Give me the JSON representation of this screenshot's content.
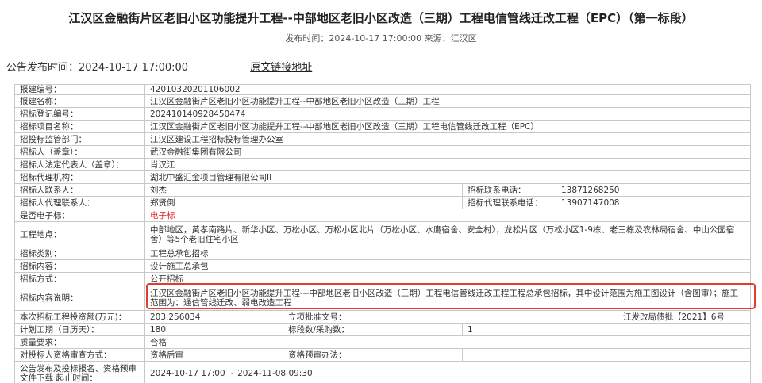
{
  "header": {
    "title": "江汉区金融街片区老旧小区功能提升工程--中部地区老旧小区改造（三期）工程电信管线迁改工程（EPC）（第一标段）",
    "meta": "发布时间：2024-10-17 17:00:00 来源：江汉区"
  },
  "publish": {
    "text": "公告发布时间：2024-10-17 17:00:00",
    "link_label": "原文链接地址"
  },
  "fields": {
    "report_no": {
      "label": "报建编号：",
      "value": "42010320201106002"
    },
    "report_name": {
      "label": "报建名称：",
      "value": "江汉区金融街片区老旧小区功能提升工程--中部地区老旧小区改造（三期）工程"
    },
    "reg_no": {
      "label": "招标登记编号：",
      "value": "202410140928450474"
    },
    "project_name": {
      "label": "招标项目名称：",
      "value": "江汉区金融街片区老旧小区功能提升工程--中部地区老旧小区改造（三期）工程电信管线迁改工程（EPC）"
    },
    "supervisor": {
      "label": "招投标监管部门：",
      "value": "江汉区建设工程招标投标管理办公室"
    },
    "tenderer": {
      "label": "招标人（盖章）：",
      "value": "武汉金融街集团有限公司"
    },
    "legal_rep": {
      "label": "招标人法定代表人（盖章）：",
      "value": "肖汉江"
    },
    "agency": {
      "label": "招标代理机构：",
      "value": "湖北中盛汇金项目管理有限公司II"
    },
    "contact": {
      "label": "招标人联系人：",
      "value": "刘杰",
      "phone_label": "招标联系电话：",
      "phone": "13871268250"
    },
    "agent_contact": {
      "label": "招标人代理联系人：",
      "value": "郑贤倒",
      "phone_label": "招标代理联系电话：",
      "phone": "13907147008"
    },
    "electronic": {
      "label": "是否电子标：",
      "value": "电子标"
    },
    "location": {
      "label": "工程地点：",
      "value": "中部地区，黄孝南路片、新华小区、万松小区、万松小区北片（万松小区、水鹰宿舍、安全村），龙松片区（万松小区1-9栋、老三栋及农林局宿舍、中山公园宿舍）等5个老旧住宅小区"
    },
    "category": {
      "label": "招标类别：",
      "value": "工程总承包招标"
    },
    "content": {
      "label": "招标内容：",
      "value": "设计施工总承包"
    },
    "method": {
      "label": "招标方式：",
      "value": "公开招标"
    },
    "description": {
      "label": "招标内容说明：",
      "value": "江汉区金融街片区老旧小区功能提升工程---中部地区老旧小区改造（三期）工程电信管线迁改工程工程总承包招标，其中设计范围为施工图设计（含图审）；施工范围为：通信管线迁改、弱电改造工程"
    },
    "investment": {
      "label": "本次招标工程投资额(万元)：",
      "value": "203.256034",
      "approval_label": "立项批准文号：",
      "approval": "江发改局债批【2021】6号"
    },
    "duration": {
      "label": "计划工期（日历天）：",
      "value": "180",
      "sections_label": "标段数/采购数：",
      "sections": "1"
    },
    "quality": {
      "label": "质量要求：",
      "value": "合格"
    },
    "qualification": {
      "label": "对投标人资格审查方式：",
      "value": "资格后审",
      "pre_label": "资格预审办法：",
      "pre": ""
    },
    "period": {
      "label": "公告发布及投标报名、资格预审文件下载 起止时间：",
      "value": "2024-10-17 17:00 ~ 2024-11-08 09:30"
    }
  }
}
